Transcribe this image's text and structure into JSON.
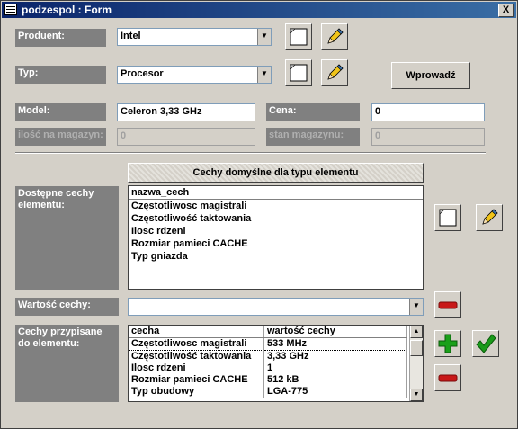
{
  "window": {
    "title": "podzespol : Form",
    "close_label": "X"
  },
  "producer": {
    "label": "Produent:",
    "value": "Intel"
  },
  "type": {
    "label": "Typ:",
    "value": "Procesor"
  },
  "enter_button": "Wprowadź",
  "model": {
    "label": "Model:",
    "value": "Celeron 3,33 GHz"
  },
  "price": {
    "label": "Cena:",
    "value": "0"
  },
  "quantity": {
    "label": "ilość na magazyn:",
    "value": "0"
  },
  "stock": {
    "label": "stan magazynu:",
    "value": "0"
  },
  "defaults_button": "Cechy domyślne dla typu elementu",
  "available": {
    "label": "Dostępne cechy elementu:",
    "header": "nazwa_cech",
    "items": [
      "Częstotliwosc magistrali",
      "Częstotliwość taktowania",
      "Ilosc rdzeni",
      "Rozmiar pamieci CACHE",
      "Typ gniazda"
    ]
  },
  "feature_value": {
    "label": "Wartość cechy:",
    "value": ""
  },
  "assigned": {
    "label": "Cechy przypisane do elementu:",
    "columns": [
      "cecha",
      "wartość cechy"
    ],
    "rows": [
      [
        "Częstotliwosc magistrali",
        "533 MHz"
      ],
      [
        "Częstotliwość taktowania",
        "3,33 GHz"
      ],
      [
        "Ilosc rdzeni",
        "1"
      ],
      [
        "Rozmiar pamieci CACHE",
        "512 kB"
      ],
      [
        "Typ obudowy",
        "LGA-775"
      ]
    ]
  },
  "colors": {
    "title_bar": "#0a246a",
    "label_bg": "#808080",
    "form_bg": "#d4d0c8",
    "plus": "#1aa01a",
    "minus": "#c81818",
    "check": "#1a9a1a"
  },
  "icons": [
    "new-record-icon",
    "edit-pencil-icon",
    "plus-icon",
    "minus-icon",
    "checkmark-icon"
  ]
}
